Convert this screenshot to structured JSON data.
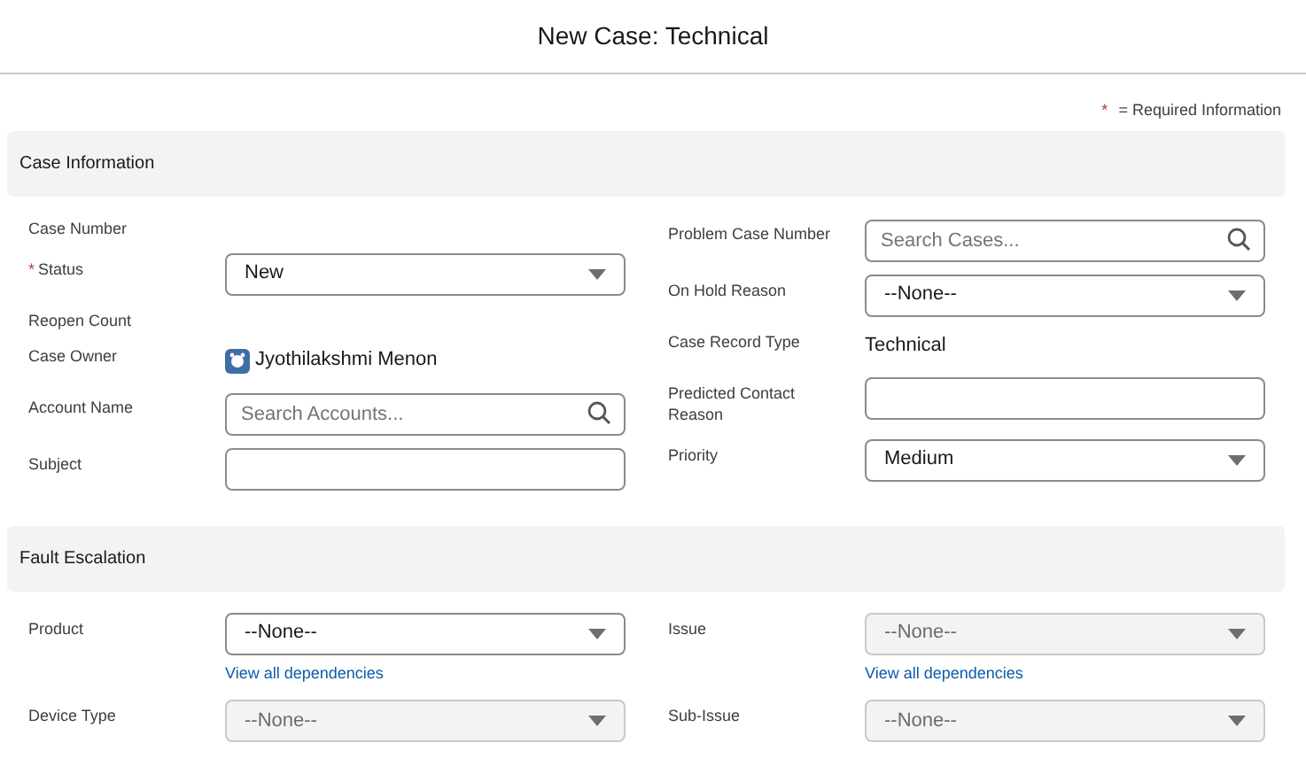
{
  "title": "New Case: Technical",
  "required_note": {
    "mark": "*",
    "text": "= Required Information"
  },
  "sections": [
    {
      "title": "Case Information",
      "columns": [
        [
          {
            "label": "Case Number",
            "kind": "label",
            "required": false
          },
          {
            "label": "Status",
            "kind": "select",
            "required": true,
            "value": "New",
            "disabled": false
          },
          {
            "label": "Reopen Count",
            "kind": "label",
            "required": false
          },
          {
            "label": "Case Owner",
            "kind": "owner",
            "required": false,
            "value": "Jyothilakshmi Menon"
          },
          {
            "label": "Account Name",
            "kind": "lookup",
            "required": false,
            "placeholder": "Search Accounts..."
          },
          {
            "label": "Subject",
            "kind": "input",
            "required": false
          }
        ],
        [
          {
            "label": "Problem Case Number",
            "kind": "lookup",
            "required": false,
            "placeholder": "Search Cases..."
          },
          {
            "label": "On Hold Reason",
            "kind": "select",
            "required": false,
            "value": "--None--",
            "disabled": false
          },
          {
            "label": "Case Record Type",
            "kind": "readonly",
            "required": false,
            "value": "Technical"
          },
          {
            "label": "Predicted Contact Reason",
            "kind": "input",
            "required": false
          },
          {
            "label": "Priority",
            "kind": "select",
            "required": false,
            "value": "Medium",
            "disabled": false
          }
        ]
      ]
    },
    {
      "title": "Fault Escalation",
      "columns": [
        [
          {
            "label": "Product",
            "kind": "select",
            "required": false,
            "value": "--None--",
            "disabled": false,
            "link": "View all dependencies"
          },
          {
            "label": "Device Type",
            "kind": "select",
            "required": false,
            "value": "--None--",
            "disabled": true
          }
        ],
        [
          {
            "label": "Issue",
            "kind": "select",
            "required": false,
            "value": "--None--",
            "disabled": true,
            "link": "View all dependencies"
          },
          {
            "label": "Sub-Issue",
            "kind": "select",
            "required": false,
            "value": "--None--",
            "disabled": true
          }
        ]
      ]
    }
  ]
}
